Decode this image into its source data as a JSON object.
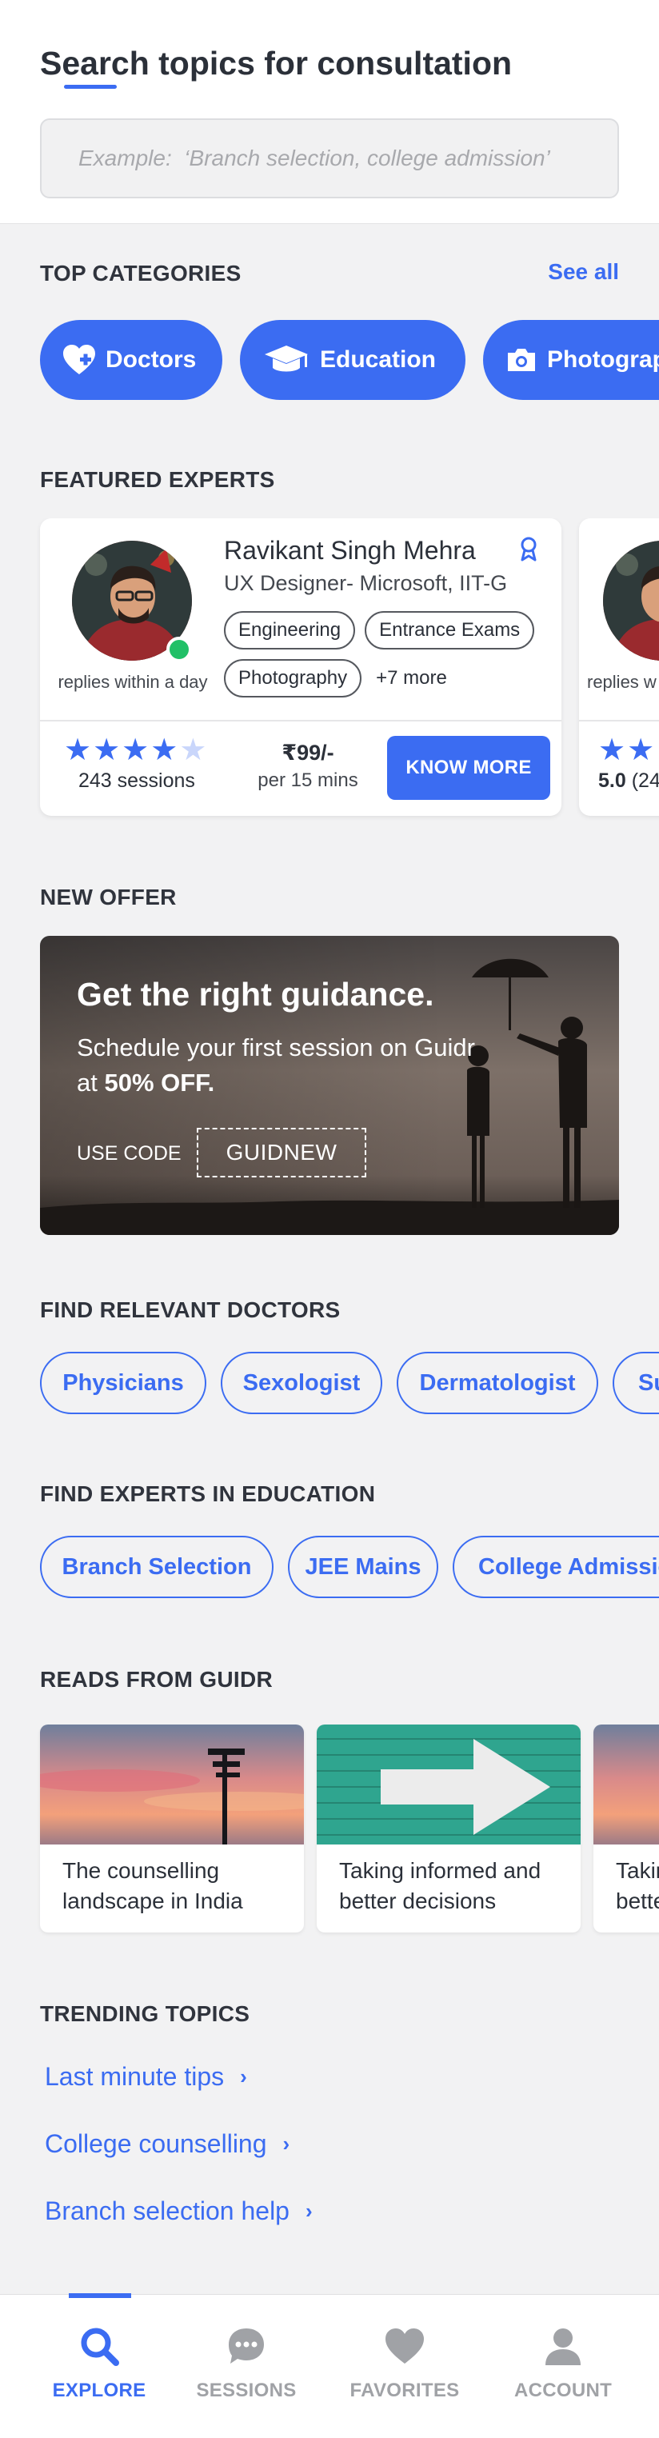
{
  "header": {
    "title": "Search topics for consultation",
    "search_placeholder": "Example:  ‘Branch selection, college admission’"
  },
  "categories": {
    "label": "TOP CATEGORIES",
    "see_all": "See all",
    "items": [
      {
        "label": "Doctors",
        "icon": "medical-heart-icon"
      },
      {
        "label": "Education",
        "icon": "graduation-cap-icon"
      },
      {
        "label": "Photography",
        "icon": "camera-icon"
      }
    ]
  },
  "featured": {
    "label": "FEATURED EXPERTS",
    "experts": [
      {
        "name": "Ravikant Singh Mehra",
        "role": "UX Designer- Microsoft, IIT-G",
        "tags": [
          "Engineering",
          "Entrance Exams",
          "Photography"
        ],
        "more": "+7 more",
        "replies": "replies within a day",
        "rating": 4,
        "sessions": "243 sessions",
        "price": "₹99/-",
        "per": "per 15 mins",
        "cta": "KNOW MORE"
      },
      {
        "replies": "replies w",
        "rating_text": "5.0",
        "sessions_partial": "(24"
      }
    ]
  },
  "offer": {
    "label": "NEW OFFER",
    "title": "Get the right guidance.",
    "desc_prefix": "Schedule your first session on Guidr at ",
    "desc_bold": "50% OFF.",
    "use_code": "USE CODE",
    "code": "GUIDNEW"
  },
  "doctors": {
    "label": "FIND RELEVANT DOCTORS",
    "items": [
      "Physicians",
      "Sexologist",
      "Dermatologist",
      "Surgeon"
    ]
  },
  "education": {
    "label": "FIND EXPERTS IN EDUCATION",
    "items": [
      "Branch Selection",
      "JEE Mains",
      "College Admission"
    ]
  },
  "reads": {
    "label": "READS FROM GUIDR",
    "items": [
      {
        "title": "The counselling landscape in India"
      },
      {
        "title": "Taking informed and better decisions"
      },
      {
        "title": "Taking informed and better decisions"
      }
    ]
  },
  "trending": {
    "label": "TRENDING TOPICS",
    "items": [
      "Last minute tips",
      "College counselling",
      "Branch selection help"
    ]
  },
  "nav": {
    "items": [
      {
        "label": "EXPLORE",
        "icon": "search-icon",
        "active": true
      },
      {
        "label": "SESSIONS",
        "icon": "chat-icon",
        "active": false
      },
      {
        "label": "FAVORITES",
        "icon": "heart-icon",
        "active": false
      },
      {
        "label": "ACCOUNT",
        "icon": "user-icon",
        "active": false
      }
    ]
  },
  "colors": {
    "accent": "#3b6cf2",
    "background": "#f2f2f3",
    "online": "#21c067",
    "nav_inactive": "#a0a2a6"
  }
}
